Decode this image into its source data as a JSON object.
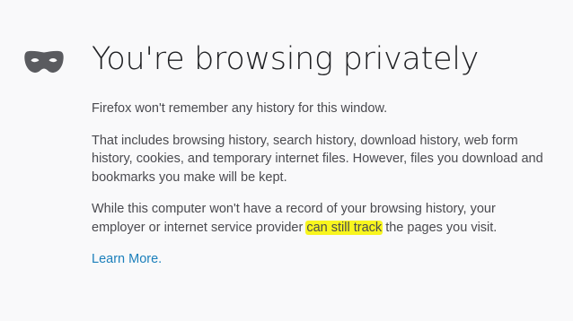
{
  "privateBrowsing": {
    "mask_icon": "private-browsing-mask-icon",
    "title": "You're browsing privately",
    "paragraph1": "Firefox won't remember any history for this window.",
    "paragraph2": "That includes browsing history, search history, download history, web form history, cookies, and temporary internet files. However, files you download and bookmarks you make will be kept.",
    "paragraph3_before": "While this computer won't have a record of your browsing history, your employer or internet service provider",
    "paragraph3_highlight": "can still track",
    "paragraph3_after": "the pages you visit.",
    "learn_more": "Learn More."
  },
  "colors": {
    "background": "#f9f9fa",
    "text": "#4a4a4f",
    "title": "#202124",
    "link": "#1b7fbb",
    "highlight": "#f8f51e",
    "icon": "#5a5b5f"
  }
}
